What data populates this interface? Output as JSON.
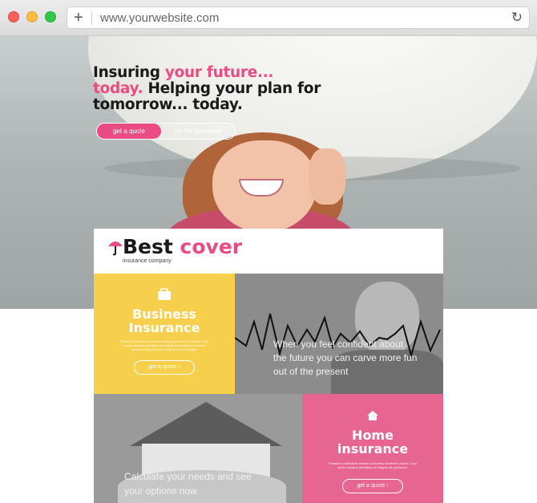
{
  "browser": {
    "url": "www.yourwebsite.com",
    "new_tab_symbol": "+",
    "reload_symbol": "↻"
  },
  "hero": {
    "headline_line1_a": "Insuring ",
    "headline_line1_b": "your future...",
    "headline_line2_a": "today.",
    "headline_line2_b": " Helping your plan for",
    "headline_line3": "tomorrow... today.",
    "cta_quote": "get a quote",
    "cta_life": "on life insurance"
  },
  "brand": {
    "name_a": "Best",
    "name_b": " cover",
    "tagline": "insurance company"
  },
  "tiles": {
    "business": {
      "icon": "briefcase-icon",
      "title_line1": "Business",
      "title_line2": "Insurance",
      "description": "Praesent vestibulum aenean nonummy hendrerit mauris. Cum sociis natoque penatibus et magnis dis parturient montes nascetur ridiculus mus. Nulla dui fusce feugiat.",
      "button": "get a quote ›"
    },
    "graph": {
      "text": "When you feel confident about the future you can carve more fun out of the present"
    },
    "house": {
      "text": "Calculate your needs and see your options now"
    },
    "home": {
      "icon": "home-icon",
      "title_line1": "Home",
      "title_line2": "insurance",
      "description": "Praesent vestibulum aenean nonummy hendrerit mauris. Cum sociis natoque penatibus et magnis dis parturient.",
      "button": "get a quote ›"
    }
  },
  "colors": {
    "accent_pink": "#e84c82",
    "business_yellow": "#f6d04d",
    "home_pink": "#e66591"
  }
}
